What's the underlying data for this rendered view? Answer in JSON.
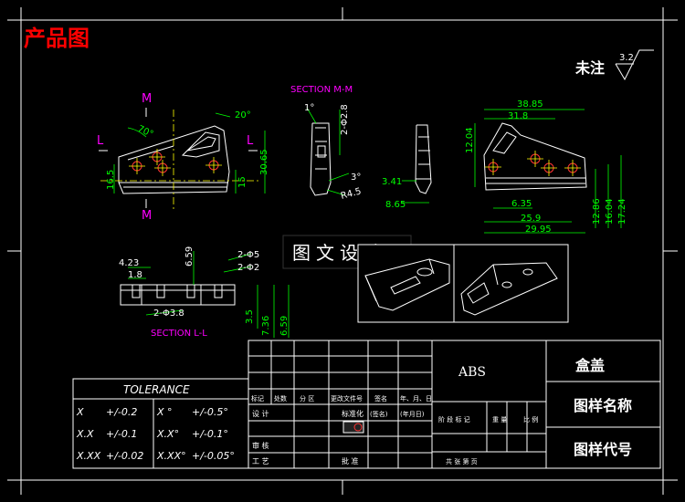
{
  "colors": {
    "background": "#000000",
    "line": "#ffffff",
    "dimension": "#00ff00",
    "section": "#ff00ff",
    "title_red": "#ff0000",
    "yellow": "#ffff00",
    "center": "#ff3333"
  },
  "drawing_title": "产品图",
  "roughness_note": "未注",
  "roughness_value": "3.2",
  "sections": {
    "mm": "SECTION M-M",
    "ll": "SECTION L-L"
  },
  "view_markers": {
    "m": "M",
    "l": "L"
  },
  "watermark": "图文设计",
  "dims": {
    "front_angle": "70°",
    "front_angle_top": "20°",
    "front_h1": "16.5",
    "front_h2": "15",
    "front_h3": "30.65",
    "mm_angle": "1°",
    "mm_dia": "2-Φ2.8",
    "mm_angle2": "3°",
    "mm_r": "R4.5",
    "side_w1": "38.85",
    "side_w2": "31.8",
    "side_h1": "12.04",
    "side_w3": "6.35",
    "side_w4": "25.9",
    "side_w5": "29.95",
    "side_h2": "12.86",
    "side_h3": "16.04",
    "side_h4": "17.24",
    "side_l1": "3.41",
    "side_l2": "8.65",
    "ll_w1": "4.23",
    "ll_w2": "1.8",
    "ll_h1": "6.59",
    "ll_d1": "2-Φ5",
    "ll_d2": "2-Φ2",
    "ll_d3": "2-Φ3.8",
    "ll_h2": "3.5",
    "ll_h3": "7.36",
    "ll_h4": "6.59"
  },
  "tolerance": {
    "title": "TOLERANCE",
    "rows": [
      {
        "a": "X",
        "b": "+/-0.2",
        "c": "X °",
        "d": "+/-0.5°"
      },
      {
        "a": "X.X",
        "b": "+/-0.1",
        "c": "X.X°",
        "d": "+/-0.1°"
      },
      {
        "a": "X.XX",
        "b": "+/-0.02",
        "c": "X.XX°",
        "d": "+/-0.05°"
      }
    ]
  },
  "title_block": {
    "material": "ABS",
    "part_name": "盒盖",
    "drawing_name_label": "图样名称",
    "drawing_code_label": "图样代号",
    "rev_headers": [
      "标记",
      "处数",
      "分 区",
      "更改文件号",
      "签名",
      "年、月、日"
    ],
    "design": "设 计",
    "standard": "标准化",
    "sign": "(签名)",
    "date": "(年月日)",
    "stage_headers": [
      "阶 段 标 记",
      "重 量",
      "比 例"
    ],
    "review": "审 核",
    "process": "工 艺",
    "approve": "批 准",
    "sheet": "共    张    第    页"
  }
}
